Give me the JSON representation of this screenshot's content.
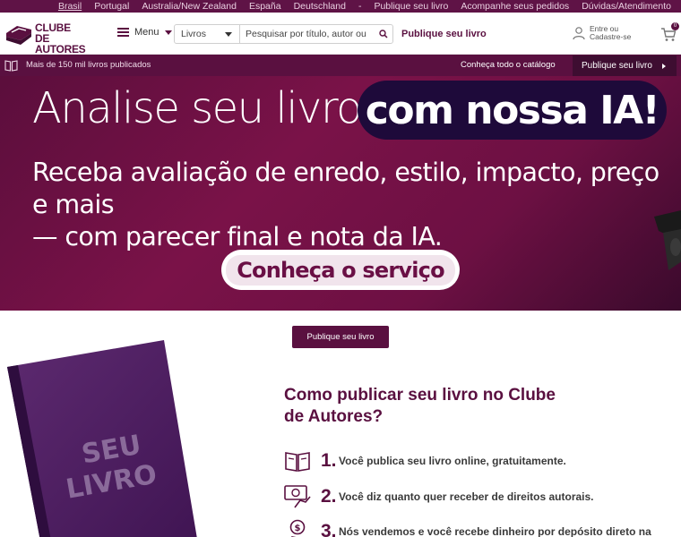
{
  "topbar": {
    "links": [
      "Brasil",
      "Portugal",
      "Australia/New Zealand",
      "España",
      "Deutschland",
      "-",
      "Publique seu livro",
      "Acompanhe seus pedidos",
      "Dúvidas/Atendimento"
    ]
  },
  "header": {
    "logo_line1": "CLUBE DE",
    "logo_line2": "AUTORES",
    "menu_label": "Menu",
    "search_category": "Livros",
    "search_placeholder": "Pesquisar por título, autor ou ISBN",
    "publish_link": "Publique seu livro",
    "login_line1": "Entre ou",
    "login_line2": "Cadastre-se",
    "cart_count": "0"
  },
  "subnav": {
    "books_count": "Mais de 150 mil livros publicados",
    "catalog_link": "Conheça todo o catálogo",
    "publish_button": "Publique seu livro"
  },
  "banner": {
    "title_left": "Analise seu livro",
    "title_pill": "com nossa IA!",
    "subtitle_line1": "Receba avaliação de enredo, estilo, impacto, preço e mais",
    "subtitle_line2": "— com parecer final e nota da IA.",
    "cta": "Conheça o serviço"
  },
  "main": {
    "publish_button": "Publique seu livro",
    "book_cover_line1": "SEU",
    "book_cover_line2": "LIVRO",
    "how_title": "Como publicar seu livro no Clube de Autores?",
    "steps": [
      {
        "num": "1.",
        "text": "Você publica seu livro online, gratuitamente."
      },
      {
        "num": "2.",
        "text": "Você diz quanto quer receber de direitos autorais."
      },
      {
        "num": "3.",
        "text": "Nós vendemos e você recebe dinheiro por depósito direto na"
      }
    ]
  },
  "colors": {
    "brand": "#5a1040",
    "topbar": "#5f1346",
    "pill": "#1e0a3a"
  }
}
